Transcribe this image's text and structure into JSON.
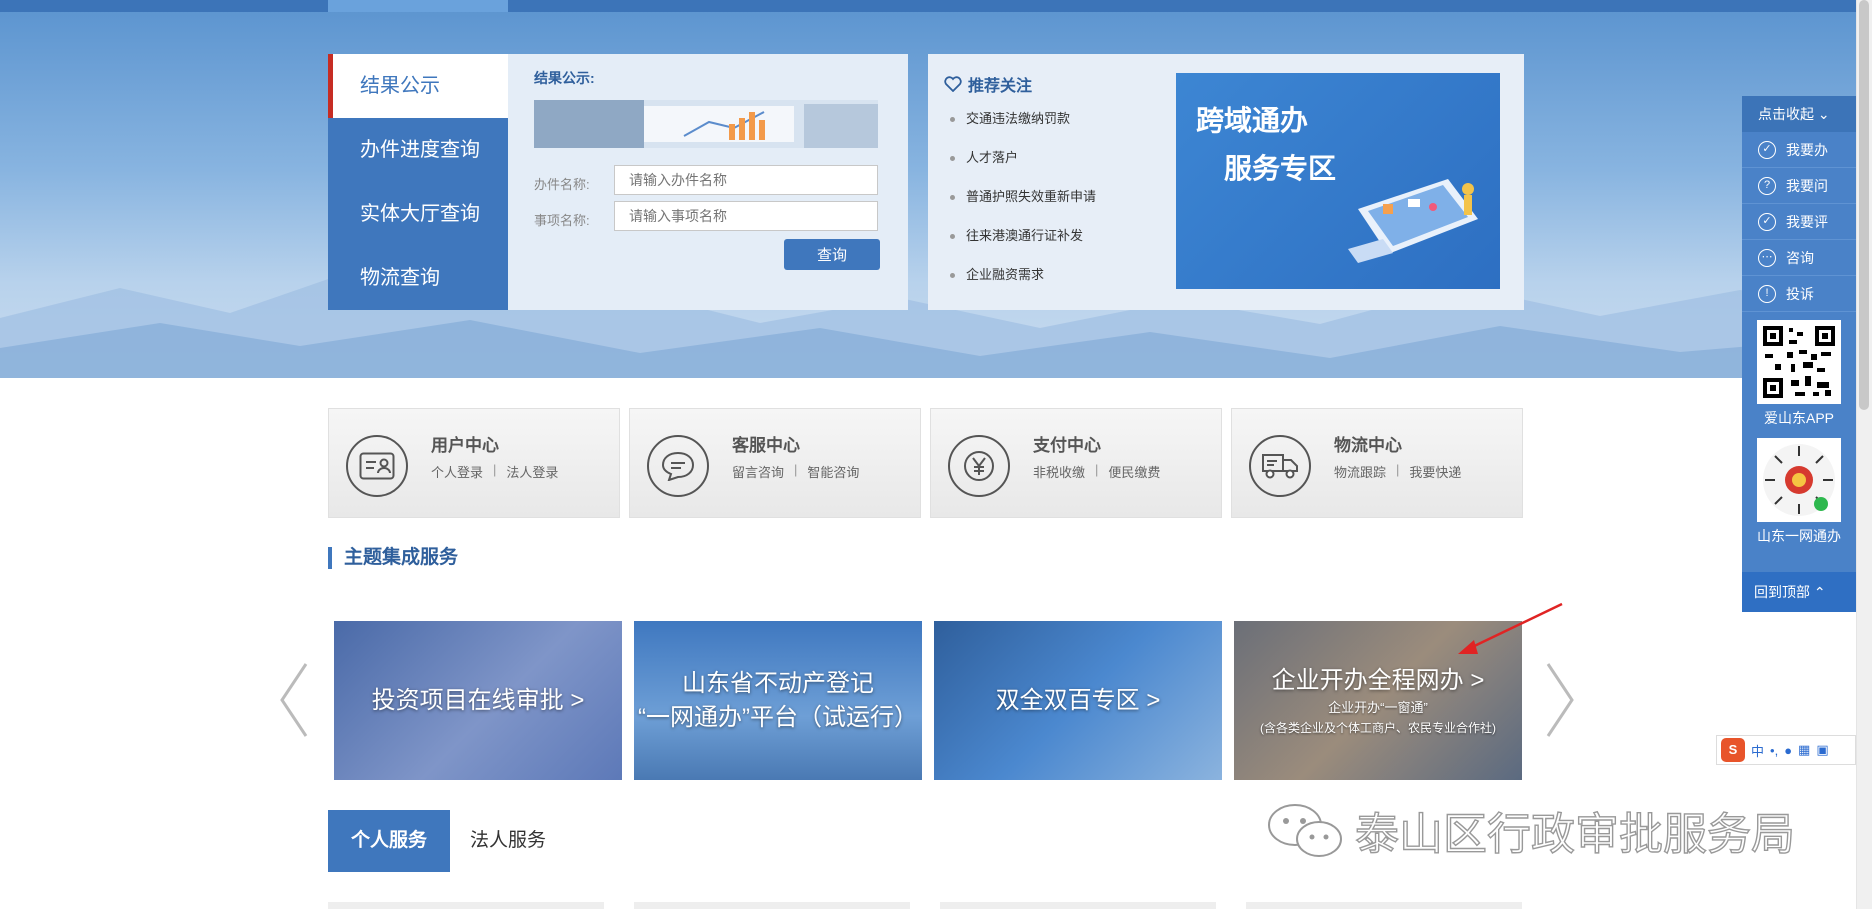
{
  "query_panel": {
    "tabs": [
      "结果公示",
      "办件进度查询",
      "实体大厅查询",
      "物流查询"
    ],
    "form_title": "结果公示:",
    "fields": [
      {
        "label": "办件名称:",
        "placeholder": "请输入办件名称"
      },
      {
        "label": "事项名称:",
        "placeholder": "请输入事项名称"
      }
    ],
    "submit": "查询"
  },
  "recommend": {
    "title": "推荐关注",
    "items": [
      "交通违法缴纳罚款",
      "人才落户",
      "普通护照失效重新申请",
      "往来港澳通行证补发",
      "企业融资需求"
    ],
    "banner_line1": "跨域通办",
    "banner_line2": "服务专区"
  },
  "services": [
    {
      "title": "用户中心",
      "links": [
        "个人登录",
        "法人登录"
      ],
      "icon": "id-card-icon"
    },
    {
      "title": "客服中心",
      "links": [
        "留言咨询",
        "智能咨询"
      ],
      "icon": "chat-bubble-icon"
    },
    {
      "title": "支付中心",
      "links": [
        "非税收缴",
        "便民缴费"
      ],
      "icon": "yen-icon"
    },
    {
      "title": "物流中心",
      "links": [
        "物流跟踪",
        "我要快递"
      ],
      "icon": "truck-icon"
    }
  ],
  "link_separator": "|",
  "theme": {
    "heading": "主题集成服务",
    "tiles": [
      {
        "lines": [
          "投资项目在线审批 >"
        ],
        "sub": []
      },
      {
        "lines": [
          "山东省不动产登记",
          "“一网通办”平台（试运行）"
        ],
        "sub": []
      },
      {
        "lines": [
          "双全双百专区 >"
        ],
        "sub": []
      },
      {
        "lines": [
          "企业开办全程网办 >"
        ],
        "sub": [
          "企业开办“一窗通”",
          "(含各类企业及个体工商户、农民专业合作社)"
        ]
      }
    ]
  },
  "person_tabs": [
    "个人服务",
    "法人服务"
  ],
  "side_panel": {
    "collapse": "点击收起",
    "items": [
      {
        "label": "我要办",
        "icon": "calendar-check-icon"
      },
      {
        "label": "我要问",
        "icon": "question-icon"
      },
      {
        "label": "我要评",
        "icon": "check-circle-icon"
      },
      {
        "label": "咨询",
        "icon": "chat-icon"
      },
      {
        "label": "投诉",
        "icon": "alert-icon"
      }
    ],
    "qr_captions": [
      "爱山东APP",
      "山东一网通办"
    ],
    "back_top": "回到顶部"
  },
  "watermark": "泰山区行政审批服务局",
  "ime": {
    "logo": "S",
    "mode": "中"
  }
}
